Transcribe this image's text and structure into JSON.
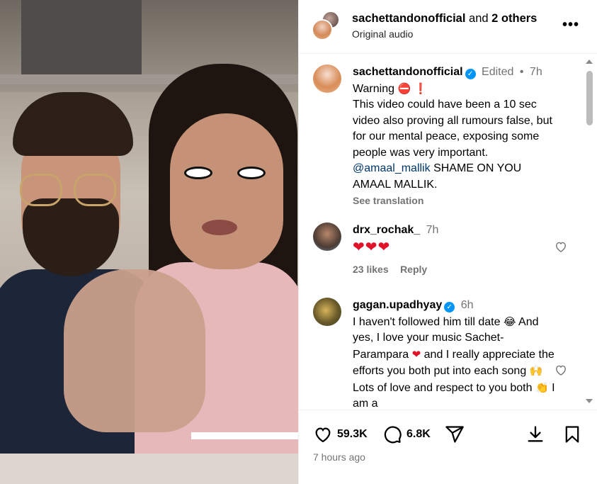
{
  "header": {
    "user": "sachettandonofficial",
    "and_text": "and",
    "others": "2 others",
    "audio": "Original audio",
    "more_icon": "more-horizontal-icon"
  },
  "caption": {
    "user": "sachettandonofficial",
    "edited": "Edited",
    "dot": "•",
    "time": "7h",
    "line1": "Warning",
    "line1_emoji": "⛔ ❗",
    "text": "This video could have been a 10 sec video also proving all rumours false, but for our mental peace, exposing some people was very important.",
    "mention": "@amaal_mallik",
    "after_mention": "SHAME ON YOU AMAAL MALLIK.",
    "see_translation": "See translation"
  },
  "comments": [
    {
      "user": "drx_rochak_",
      "time": "7h",
      "text": "❤❤❤",
      "likes": "23 likes",
      "reply": "Reply"
    },
    {
      "user": "gagan.upadhyay",
      "time": "6h",
      "text_a": "I haven't followed him till date",
      "emoji_a": "😂",
      "text_b": "And yes, I love your music Sachet-Parampara",
      "emoji_b": "❤",
      "text_c": "and I really appreciate the efforts you both put into each song",
      "emoji_c": "🙌",
      "text_d": "Lots of love and respect to you both",
      "emoji_d": "👏",
      "text_e": "I am a"
    }
  ],
  "actions": {
    "likes": "59.3K",
    "comments": "6.8K",
    "posted": "7 hours ago"
  },
  "colors": {
    "verified": "#0095f6",
    "mention": "#00376b",
    "secondary": "#737373",
    "heart_red": "#e0122a"
  }
}
